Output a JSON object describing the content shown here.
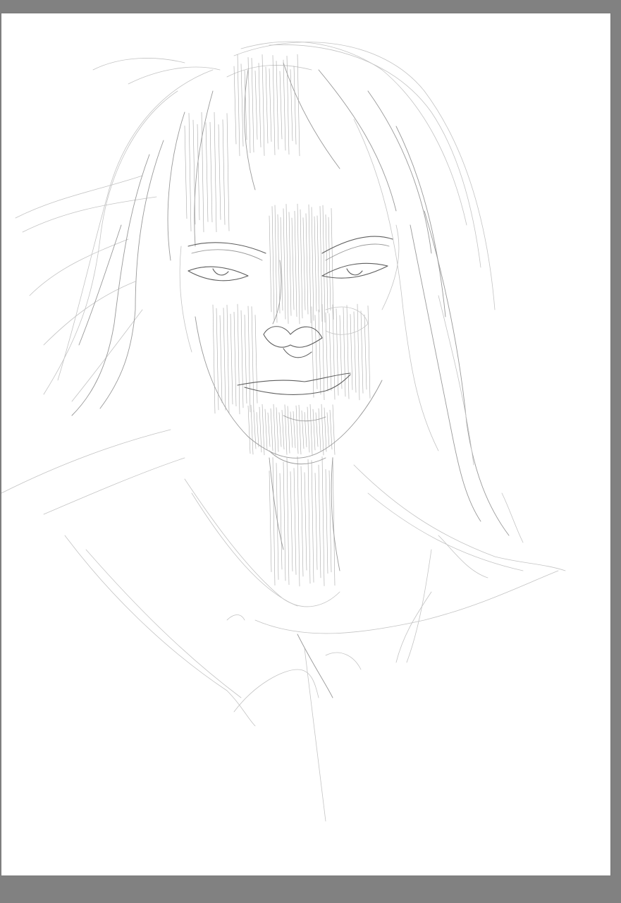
{
  "app": {
    "workspace_color": "#808080",
    "canvas_color": "#ffffff"
  },
  "canvas": {
    "content": "pencil-sketch-portrait",
    "stroke_colors": [
      "#c4c4c4",
      "#9a9a9a",
      "#5e5e5e"
    ]
  }
}
